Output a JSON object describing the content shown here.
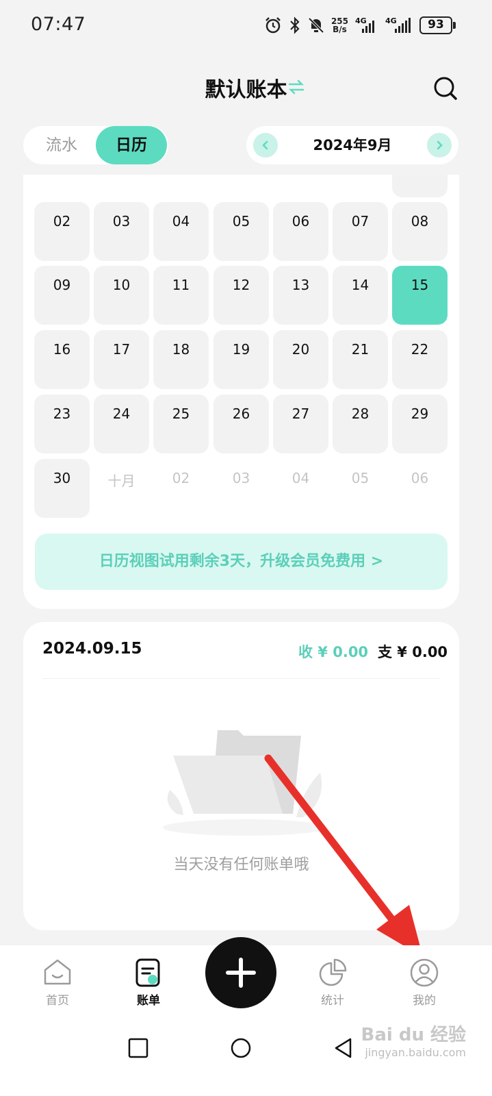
{
  "status_bar": {
    "time": "07:47",
    "net_speed_value": "255",
    "net_speed_unit": "B/s",
    "network_1": "4G",
    "network_2": "4G",
    "battery": "93"
  },
  "header": {
    "title": "默认账本",
    "swap_icon": "swap-arrows-icon",
    "search_icon": "search-icon"
  },
  "segment": {
    "liushui": "流水",
    "rili": "日历",
    "active": "rili"
  },
  "month_nav": {
    "label": "2024年9月",
    "prev_icon": "chevron-left-icon",
    "next_icon": "chevron-right-icon"
  },
  "calendar": {
    "weeks": [
      [
        {
          "label": "02"
        },
        {
          "label": "03"
        },
        {
          "label": "04"
        },
        {
          "label": "05"
        },
        {
          "label": "06"
        },
        {
          "label": "07"
        },
        {
          "label": "08"
        }
      ],
      [
        {
          "label": "09"
        },
        {
          "label": "10"
        },
        {
          "label": "11"
        },
        {
          "label": "12"
        },
        {
          "label": "13"
        },
        {
          "label": "14"
        },
        {
          "label": "15",
          "selected": true
        }
      ],
      [
        {
          "label": "16"
        },
        {
          "label": "17"
        },
        {
          "label": "18"
        },
        {
          "label": "19"
        },
        {
          "label": "20"
        },
        {
          "label": "21"
        },
        {
          "label": "22"
        }
      ],
      [
        {
          "label": "23"
        },
        {
          "label": "24"
        },
        {
          "label": "25"
        },
        {
          "label": "26"
        },
        {
          "label": "27"
        },
        {
          "label": "28"
        },
        {
          "label": "29"
        }
      ],
      [
        {
          "label": "30"
        },
        {
          "label": "十月",
          "muted": true
        },
        {
          "label": "02",
          "muted": true
        },
        {
          "label": "03",
          "muted": true
        },
        {
          "label": "04",
          "muted": true
        },
        {
          "label": "05",
          "muted": true
        },
        {
          "label": "06",
          "muted": true
        }
      ]
    ],
    "promo": "日历视图试用剩余3天，升级会员免费用 >"
  },
  "bill": {
    "date": "2024.09.15",
    "income": "收 ¥ 0.00",
    "expense": "支 ¥ 0.00",
    "empty_text": "当天没有任何账单哦"
  },
  "tabs": [
    {
      "label": "首页",
      "icon": "home-icon"
    },
    {
      "label": "账单",
      "icon": "bill-icon",
      "active": true
    },
    {
      "label": "统计",
      "icon": "pie-chart-icon"
    },
    {
      "label": "我的",
      "icon": "user-icon"
    }
  ],
  "fab_icon": "plus-icon",
  "watermark": {
    "main": "Bai du 经验",
    "sub": "jingyan.baidu.com"
  },
  "colors": {
    "accent": "#5ddbc1",
    "accent_text": "#5ccfb9",
    "promo_bg": "#d9f8f1",
    "annotation_arrow": "#e8302a"
  }
}
